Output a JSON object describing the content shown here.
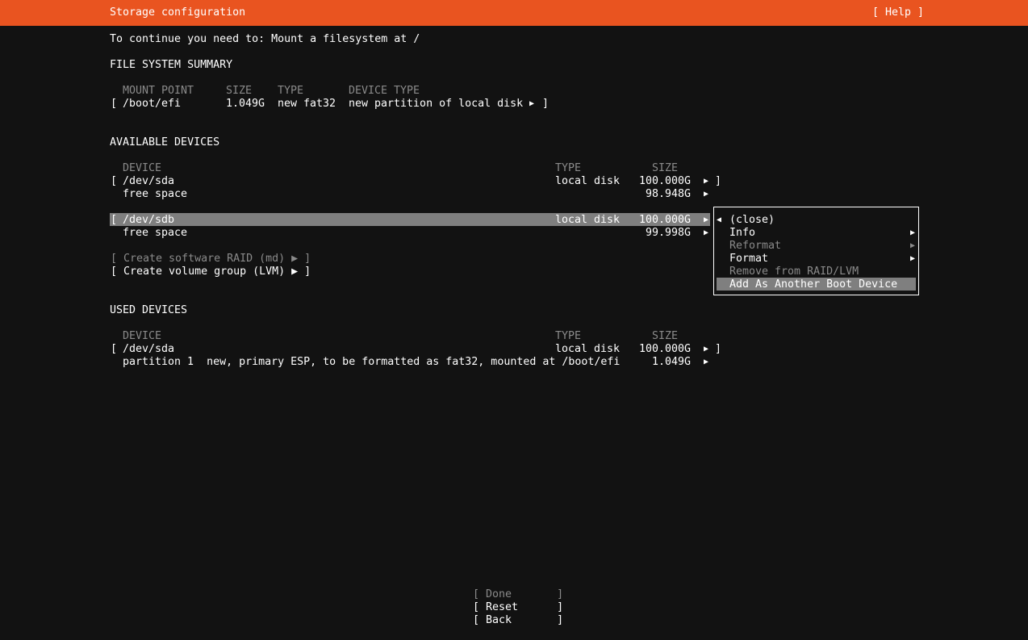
{
  "header": {
    "title": "Storage configuration",
    "help": "[ Help ]"
  },
  "instruction": "To continue you need to: Mount a filesystem at /",
  "fs_summary": {
    "heading": "FILE SYSTEM SUMMARY",
    "columns": [
      "MOUNT POINT",
      "SIZE",
      "TYPE",
      "DEVICE TYPE"
    ],
    "rows": [
      {
        "open": "[",
        "mount": "/boot/efi",
        "size": "1.049G",
        "type": "new fat32",
        "device_type": "new partition of local disk",
        "arrow": "▶",
        "close": "]"
      }
    ]
  },
  "available": {
    "heading": "AVAILABLE DEVICES",
    "columns": [
      "DEVICE",
      "TYPE",
      "SIZE"
    ],
    "devices": [
      {
        "open": "[",
        "name": "/dev/sda",
        "type": "local disk",
        "size": "100.000G",
        "arrow": "▶",
        "close": "]",
        "sub_name": "free space",
        "sub_size": "98.948G",
        "sub_arrow": "▶"
      },
      {
        "open": "[",
        "name": "/dev/sdb",
        "type": "local disk",
        "size": "100.000G",
        "arrow": "▶",
        "sub_name": "free space",
        "sub_size": "99.998G",
        "sub_arrow": "▶"
      }
    ],
    "create_raid": "[ Create software RAID (md) ▶ ]",
    "create_lvm": "[ Create volume group (LVM) ▶ ]"
  },
  "used": {
    "heading": "USED DEVICES",
    "columns": [
      "DEVICE",
      "TYPE",
      "SIZE"
    ],
    "devices": [
      {
        "open": "[",
        "name": "/dev/sda",
        "type": "local disk",
        "size": "100.000G",
        "arrow": "▶",
        "close": "]",
        "sub_name": "partition 1  new, primary ESP, to be formatted as fat32, mounted at /boot/efi",
        "sub_size": "1.049G",
        "sub_arrow": "▶"
      }
    ]
  },
  "menu": {
    "back_arrow": "◀",
    "items": [
      {
        "label": "(close)",
        "arrow": "",
        "enabled": true
      },
      {
        "label": "Info",
        "arrow": "▶",
        "enabled": true
      },
      {
        "label": "Reformat",
        "arrow": "▶",
        "enabled": false
      },
      {
        "label": "Format",
        "arrow": "▶",
        "enabled": true
      },
      {
        "label": "Remove from RAID/LVM",
        "arrow": "",
        "enabled": false
      },
      {
        "label": "Add As Another Boot Device",
        "arrow": "",
        "enabled": true,
        "selected": true
      }
    ]
  },
  "buttons": {
    "done": "[ Done       ]",
    "reset": "[ Reset      ]",
    "back": "[ Back       ]"
  },
  "colors": {
    "header_bg": "#e95420",
    "background": "#121212",
    "selection": "#7f7f7f",
    "disabled_text": "#8a8a8a"
  }
}
